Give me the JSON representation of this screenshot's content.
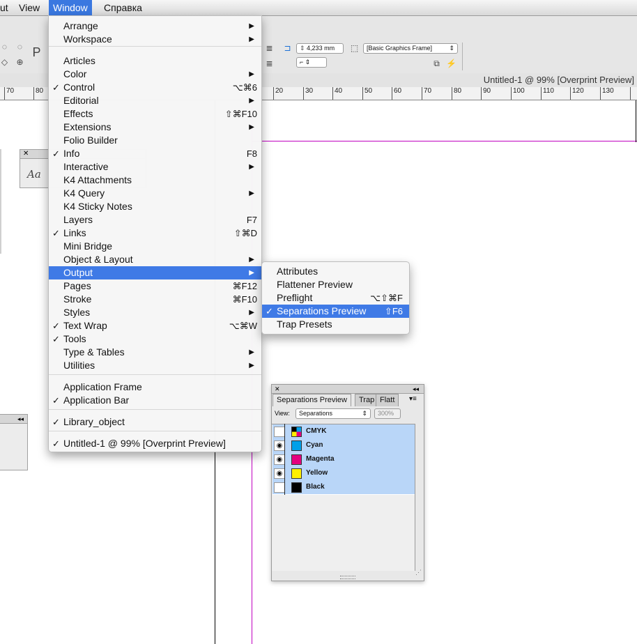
{
  "menubar": {
    "items": [
      "ut",
      "View",
      "Window",
      "Справка"
    ]
  },
  "control": {
    "dimension_value": "4,233 mm",
    "object_style": "[Basic Graphics Frame]"
  },
  "document_title": "Untitled-1 @ 99% [Overprint Preview]",
  "ruler": {
    "ticks": [
      "70",
      "80",
      "20",
      "30",
      "40",
      "50",
      "60",
      "70",
      "80",
      "90",
      "100",
      "110",
      "120",
      "130"
    ]
  },
  "window_menu": {
    "items": [
      {
        "label": "Arrange",
        "check": "",
        "shortcut": "",
        "submenu": true
      },
      {
        "label": "Workspace",
        "check": "",
        "shortcut": "",
        "submenu": true
      },
      {
        "label": "Articles",
        "check": "",
        "shortcut": "",
        "submenu": false
      },
      {
        "label": "Color",
        "check": "",
        "shortcut": "",
        "submenu": true
      },
      {
        "label": "Control",
        "check": "✓",
        "shortcut": "⌥⌘6",
        "submenu": false
      },
      {
        "label": "Editorial",
        "check": "",
        "shortcut": "",
        "submenu": true
      },
      {
        "label": "Effects",
        "check": "",
        "shortcut": "⇧⌘F10",
        "submenu": false
      },
      {
        "label": "Extensions",
        "check": "",
        "shortcut": "",
        "submenu": true
      },
      {
        "label": "Folio Builder",
        "check": "",
        "shortcut": "",
        "submenu": false
      },
      {
        "label": "Info",
        "check": "✓",
        "shortcut": "F8",
        "submenu": false
      },
      {
        "label": "Interactive",
        "check": "",
        "shortcut": "",
        "submenu": true
      },
      {
        "label": "K4 Attachments",
        "check": "",
        "shortcut": "",
        "submenu": false
      },
      {
        "label": "K4 Query",
        "check": "",
        "shortcut": "",
        "submenu": true
      },
      {
        "label": "K4 Sticky Notes",
        "check": "",
        "shortcut": "",
        "submenu": false
      },
      {
        "label": "Layers",
        "check": "",
        "shortcut": "F7",
        "submenu": false
      },
      {
        "label": "Links",
        "check": "✓",
        "shortcut": "⇧⌘D",
        "submenu": false
      },
      {
        "label": "Mini Bridge",
        "check": "",
        "shortcut": "",
        "submenu": false
      },
      {
        "label": "Object & Layout",
        "check": "",
        "shortcut": "",
        "submenu": true
      },
      {
        "label": "Output",
        "check": "",
        "shortcut": "",
        "submenu": true
      },
      {
        "label": "Pages",
        "check": "",
        "shortcut": "⌘F12",
        "submenu": false
      },
      {
        "label": "Stroke",
        "check": "",
        "shortcut": "⌘F10",
        "submenu": false
      },
      {
        "label": "Styles",
        "check": "",
        "shortcut": "",
        "submenu": true
      },
      {
        "label": "Text Wrap",
        "check": "✓",
        "shortcut": "⌥⌘W",
        "submenu": false
      },
      {
        "label": "Tools",
        "check": "✓",
        "shortcut": "",
        "submenu": false
      },
      {
        "label": "Type & Tables",
        "check": "",
        "shortcut": "",
        "submenu": true
      },
      {
        "label": "Utilities",
        "check": "",
        "shortcut": "",
        "submenu": true
      },
      {
        "label": "Application Frame",
        "check": "",
        "shortcut": "",
        "submenu": false
      },
      {
        "label": "Application Bar",
        "check": "✓",
        "shortcut": "",
        "submenu": false
      },
      {
        "label": "Library_object",
        "check": "✓",
        "shortcut": "",
        "submenu": false
      },
      {
        "label": "Untitled-1 @ 99% [Overprint Preview]",
        "check": "✓",
        "shortcut": "",
        "submenu": false
      }
    ]
  },
  "output_submenu": {
    "items": [
      {
        "label": "Attributes",
        "check": "",
        "shortcut": ""
      },
      {
        "label": "Flattener Preview",
        "check": "",
        "shortcut": ""
      },
      {
        "label": "Preflight",
        "check": "",
        "shortcut": "⌥⇧⌘F"
      },
      {
        "label": "Separations Preview",
        "check": "✓",
        "shortcut": "⇧F6"
      },
      {
        "label": "Trap Presets",
        "check": "",
        "shortcut": ""
      }
    ]
  },
  "separations_panel": {
    "tabs": [
      "Separations Preview",
      "Trap",
      "Flatt"
    ],
    "view_label": "View:",
    "view_value": "Separations",
    "zoom_value": "300%",
    "rows": [
      {
        "name": "CMYK",
        "visible": false,
        "color": "cmyk"
      },
      {
        "name": "Cyan",
        "visible": true,
        "color": "#00a0e9"
      },
      {
        "name": "Magenta",
        "visible": true,
        "color": "#e4007f"
      },
      {
        "name": "Yellow",
        "visible": true,
        "color": "#fff000"
      },
      {
        "name": "Black",
        "visible": false,
        "color": "#000000"
      }
    ]
  },
  "colors": {
    "accent": "#3f7ae6",
    "row_highlight": "#b9d6f8",
    "guide_magenta": "#c000c0"
  },
  "icons": {
    "eye": "eye-icon",
    "close": "close-icon",
    "collapse": "collapse-icon",
    "panel_menu": "panel-menu-icon"
  }
}
